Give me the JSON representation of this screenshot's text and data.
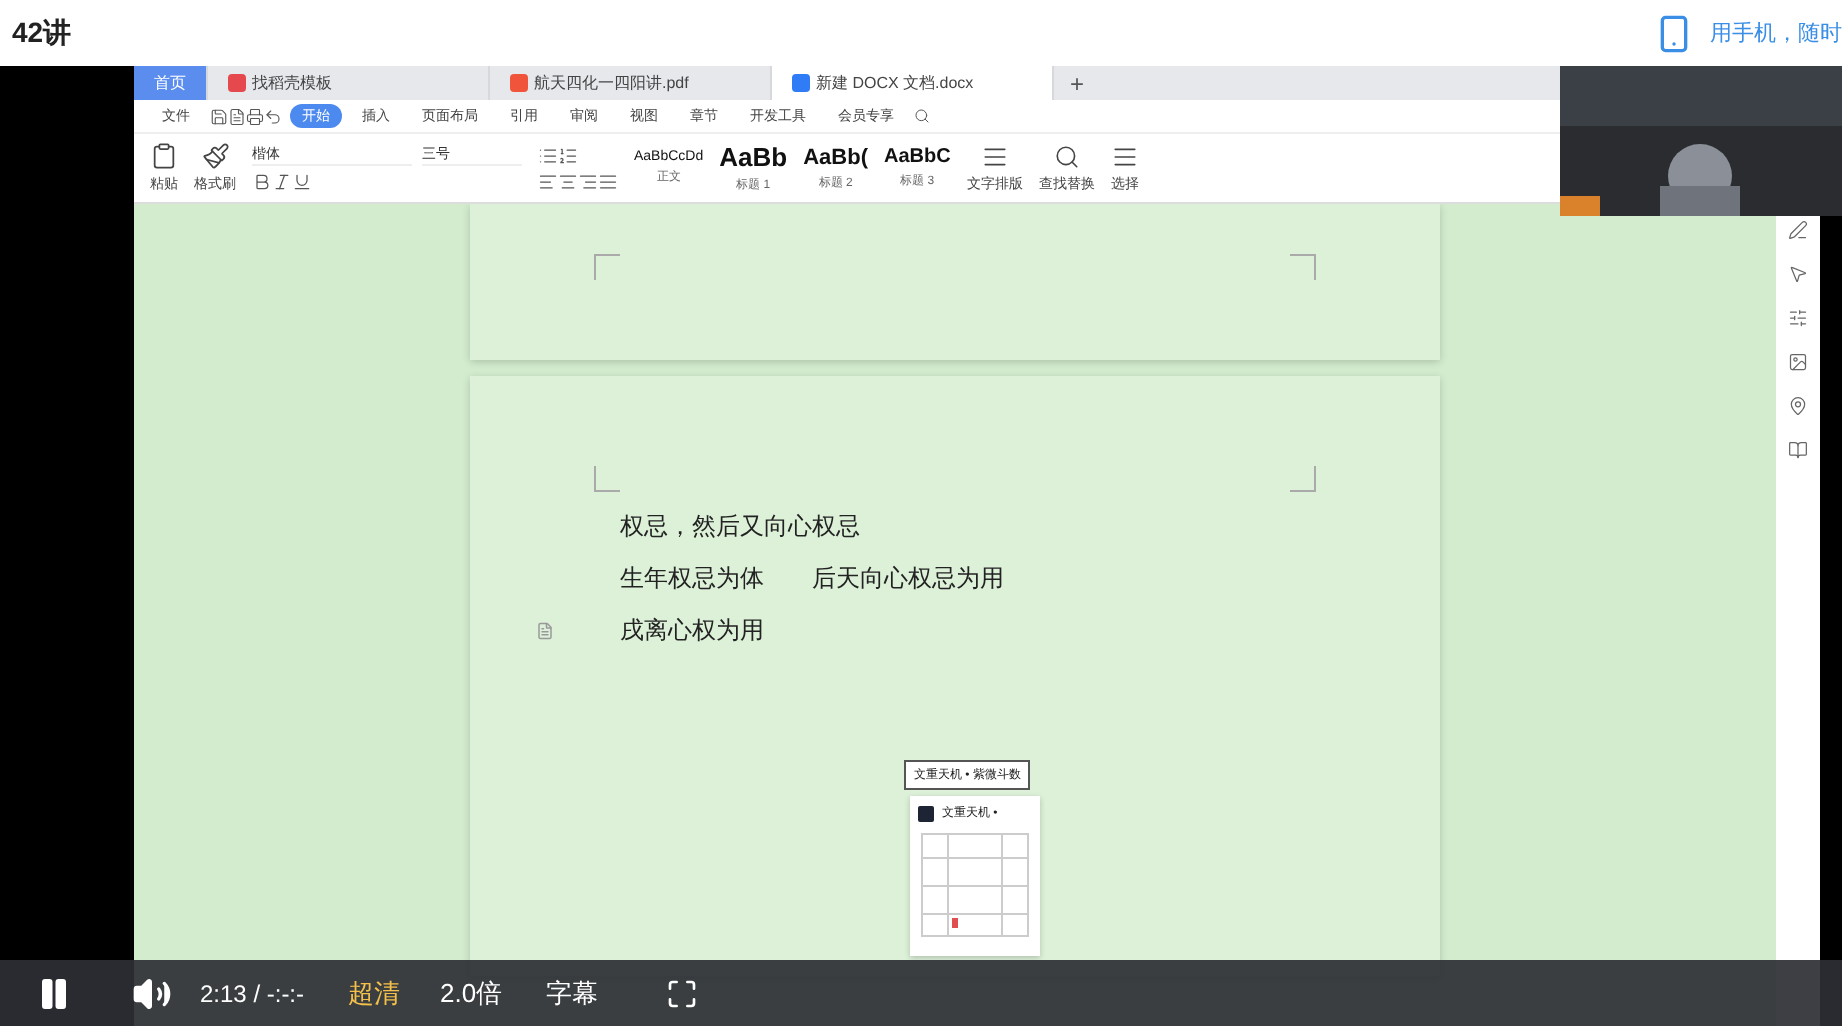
{
  "header": {
    "title": "42讲",
    "phone_link": "用手机，随时"
  },
  "wps": {
    "tabs": [
      {
        "label": "首页",
        "kind": "home",
        "selected": false
      },
      {
        "label": "找稻壳模板",
        "kind": "template",
        "selected": false
      },
      {
        "label": "航天四化一四阳讲.pdf",
        "kind": "pdf",
        "selected": false
      },
      {
        "label": "新建 DOCX 文档.docx",
        "kind": "docx",
        "selected": true
      }
    ],
    "new_tab": "+",
    "menu": [
      {
        "label": "文件",
        "selected": false
      },
      {
        "label": "开始",
        "selected": true
      },
      {
        "label": "插入",
        "selected": false
      },
      {
        "label": "页面布局",
        "selected": false
      },
      {
        "label": "引用",
        "selected": false
      },
      {
        "label": "审阅",
        "selected": false
      },
      {
        "label": "视图",
        "selected": false
      },
      {
        "label": "章节",
        "selected": false
      },
      {
        "label": "开发工具",
        "selected": false
      },
      {
        "label": "会员专享",
        "selected": false
      }
    ],
    "clipboard": [
      "粘贴",
      "格式刷"
    ],
    "font": "楷体",
    "size": "三号",
    "styles": [
      {
        "sample": "AaBbCcDd",
        "name": "正文",
        "kind": "body"
      },
      {
        "sample": "AaBb",
        "name": "标题 1",
        "kind": "h1"
      },
      {
        "sample": "AaBb(",
        "name": "标题 2",
        "kind": "h2"
      },
      {
        "sample": "AaBbC",
        "name": "标题 3",
        "kind": "h3"
      }
    ],
    "tools": [
      "文字排版",
      "查找替换",
      "选择"
    ],
    "document": {
      "lines": [
        "权忌，然后又向心权忌",
        "生年权忌为体　　后天向心权忌为用",
        "戌离心权为用"
      ]
    },
    "popup": {
      "tooltip": "文重天机 • 紫微斗数",
      "card_title": "文重天机 •"
    }
  },
  "player": {
    "playing": true,
    "time": "2:13 / -:-:-",
    "quality": "超清",
    "speed": "2.0倍",
    "subtitles": "字幕"
  }
}
